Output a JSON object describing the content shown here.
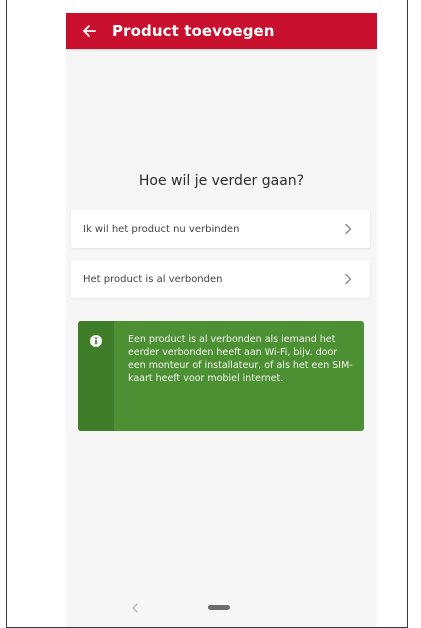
{
  "appbar": {
    "title": "Product toevoegen",
    "back_icon": "arrow-left-icon",
    "background_color": "#c8102e"
  },
  "main": {
    "question": "Hoe wil je verder gaan?",
    "options": [
      {
        "label": "Ik wil het product nu verbinden",
        "icon": "chevron-right-icon"
      },
      {
        "label": "Het product is al verbonden",
        "icon": "chevron-right-icon"
      }
    ],
    "info": {
      "icon": "info-icon",
      "text": "Een product is al verbonden als iemand het eerder verbonden heeft aan Wi-Fi, bijv. door een monteur of installateur, of als het een SIM-kaart heeft voor mobiel internet.",
      "background_color": "#4d8f33"
    }
  },
  "system_nav": {
    "back_icon": "chevron-left-icon",
    "home_icon": "home-pill-icon"
  }
}
